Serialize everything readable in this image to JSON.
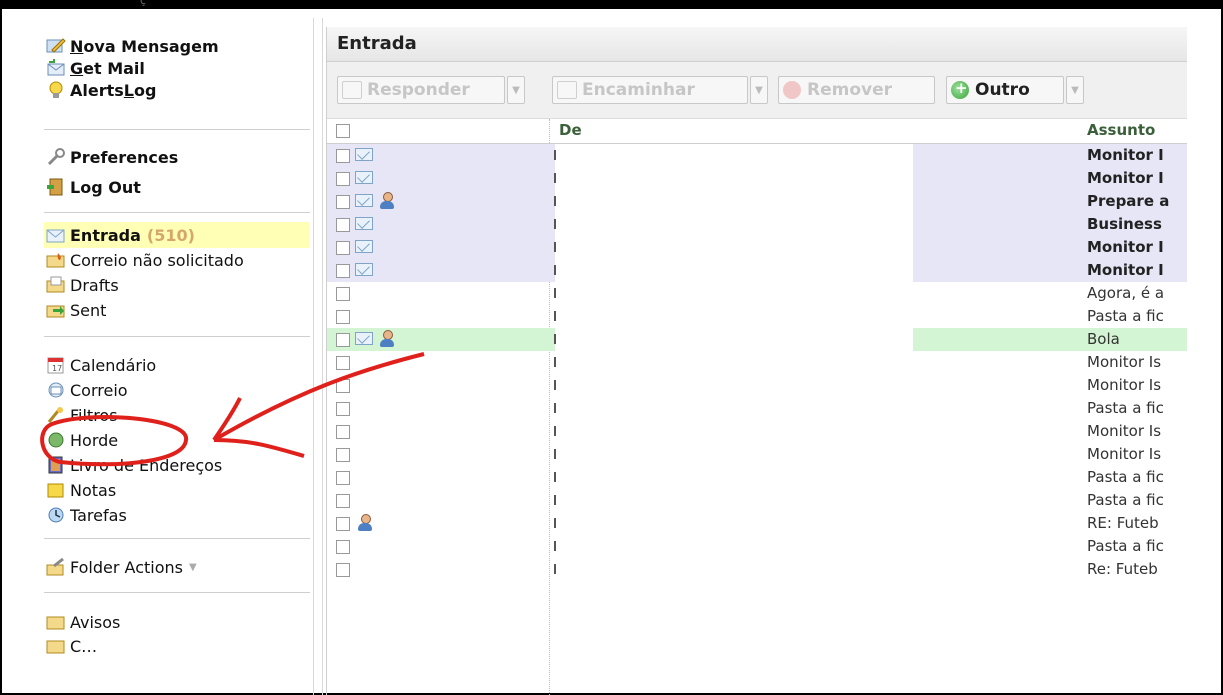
{
  "window": {
    "top_text": "ç"
  },
  "sidebar": {
    "items": [
      {
        "label_pre": "",
        "label_u": "N",
        "label_post": "ova Mensagem",
        "icon": "compose-icon"
      },
      {
        "label_pre": "",
        "label_u": "G",
        "label_post": "et Mail",
        "icon": "get-mail-icon"
      },
      {
        "label_pre": "Alerts ",
        "label_u": "L",
        "label_post": "og",
        "icon": "lightbulb-icon"
      },
      {
        "label": "Preferences",
        "icon": "wrench-icon"
      },
      {
        "label": "Log Out",
        "icon": "logout-door-icon"
      },
      {
        "label": "Entrada",
        "count": "(510)",
        "icon": "inbox-envelope-icon"
      },
      {
        "label": "Correio não solicitado",
        "icon": "spam-folder-icon"
      },
      {
        "label": "Drafts",
        "icon": "drafts-folder-icon"
      },
      {
        "label": "Sent",
        "icon": "sent-folder-icon"
      },
      {
        "label": "Calendário",
        "icon": "calendar-icon"
      },
      {
        "label": "Correio",
        "icon": "mail-icon"
      },
      {
        "label": "Filtros",
        "icon": "filter-icon"
      },
      {
        "label": "Horde",
        "icon": "horde-icon"
      },
      {
        "label": "Livro de Endereços",
        "icon": "address-book-icon"
      },
      {
        "label": "Notas",
        "icon": "notes-icon"
      },
      {
        "label": "Tarefas",
        "icon": "tasks-icon"
      },
      {
        "label": "Folder Actions",
        "icon": "folder-actions-icon"
      },
      {
        "label": "Avisos",
        "icon": "folder-icon"
      },
      {
        "label": "C…",
        "icon": "folder-icon"
      }
    ]
  },
  "main": {
    "title": "Entrada",
    "toolbar": {
      "reply": "Responder",
      "forward": "Encaminhar",
      "delete": "Remover",
      "other": "Outro"
    },
    "columns": {
      "from": "De",
      "subject": "Assunto"
    },
    "rows": [
      {
        "subject": "Monitor I",
        "unread": true,
        "person": false
      },
      {
        "subject": "Monitor I",
        "unread": true,
        "person": false
      },
      {
        "subject": "Prepare a",
        "unread": true,
        "person": true
      },
      {
        "subject": "Business",
        "unread": true,
        "person": false
      },
      {
        "subject": "Monitor I",
        "unread": true,
        "person": false
      },
      {
        "subject": "Monitor I",
        "unread": true,
        "person": false
      },
      {
        "subject": "Agora, é a",
        "unread": false,
        "person": false
      },
      {
        "subject": "Pasta a fic",
        "unread": false,
        "person": false
      },
      {
        "subject": "Bola",
        "unread": false,
        "person": true,
        "green": true
      },
      {
        "subject": "Monitor Is",
        "unread": false,
        "person": false
      },
      {
        "subject": "Monitor Is",
        "unread": false,
        "person": false
      },
      {
        "subject": "Pasta a fic",
        "unread": false,
        "person": false
      },
      {
        "subject": "Monitor Is",
        "unread": false,
        "person": false
      },
      {
        "subject": "Monitor Is",
        "unread": false,
        "person": false
      },
      {
        "subject": "Pasta a fic",
        "unread": false,
        "person": false
      },
      {
        "subject": "Pasta a fic",
        "unread": false,
        "person": false
      },
      {
        "subject": "RE: Futeb",
        "unread": false,
        "person": true
      },
      {
        "subject": "Pasta a fic",
        "unread": false,
        "person": false
      },
      {
        "subject": "Re: Futeb",
        "unread": false,
        "person": false
      }
    ]
  },
  "colors": {
    "accent_count": "#d6a66d",
    "unread_bg": "#e6e6f7",
    "selected_bg": "#d4f5d4",
    "annotation": "#e0201b"
  }
}
